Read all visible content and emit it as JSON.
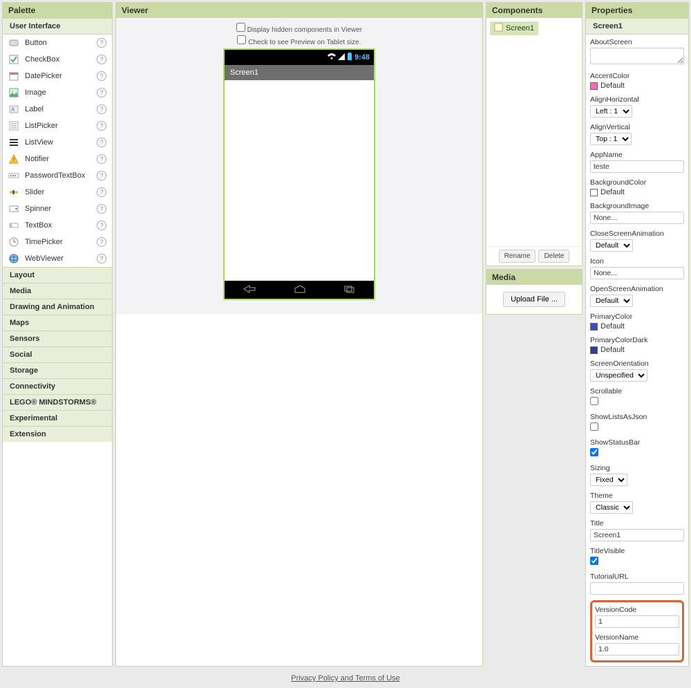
{
  "palette": {
    "title": "Palette",
    "ui_group": "User Interface",
    "items": [
      {
        "label": "Button",
        "icon": "button-icon"
      },
      {
        "label": "CheckBox",
        "icon": "checkbox-icon"
      },
      {
        "label": "DatePicker",
        "icon": "datepicker-icon"
      },
      {
        "label": "Image",
        "icon": "image-icon"
      },
      {
        "label": "Label",
        "icon": "label-icon"
      },
      {
        "label": "ListPicker",
        "icon": "listpicker-icon"
      },
      {
        "label": "ListView",
        "icon": "listview-icon"
      },
      {
        "label": "Notifier",
        "icon": "notifier-icon"
      },
      {
        "label": "PasswordTextBox",
        "icon": "password-icon"
      },
      {
        "label": "Slider",
        "icon": "slider-icon"
      },
      {
        "label": "Spinner",
        "icon": "spinner-icon"
      },
      {
        "label": "TextBox",
        "icon": "textbox-icon"
      },
      {
        "label": "TimePicker",
        "icon": "timepicker-icon"
      },
      {
        "label": "WebViewer",
        "icon": "webviewer-icon"
      }
    ],
    "groups": [
      "Layout",
      "Media",
      "Drawing and Animation",
      "Maps",
      "Sensors",
      "Social",
      "Storage",
      "Connectivity",
      "LEGO® MINDSTORMS®",
      "Experimental",
      "Extension"
    ]
  },
  "viewer": {
    "title": "Viewer",
    "opt1": "Display hidden components in Viewer",
    "opt2": "Check to see Preview on Tablet size.",
    "phone_time": "9:48",
    "screen_title": "Screen1"
  },
  "components": {
    "title": "Components",
    "root": "Screen1",
    "rename": "Rename",
    "delete": "Delete"
  },
  "media": {
    "title": "Media",
    "upload": "Upload File ..."
  },
  "properties": {
    "title": "Properties",
    "screen_name": "Screen1",
    "AboutScreen": {
      "label": "AboutScreen",
      "value": ""
    },
    "AccentColor": {
      "label": "AccentColor",
      "value": "Default",
      "color": "#ff4081"
    },
    "AlignHorizontal": {
      "label": "AlignHorizontal",
      "value": "Left : 1"
    },
    "AlignVertical": {
      "label": "AlignVertical",
      "value": "Top : 1"
    },
    "AppName": {
      "label": "AppName",
      "value": "teste"
    },
    "BackgroundColor": {
      "label": "BackgroundColor",
      "value": "Default",
      "color": "#ffffff"
    },
    "BackgroundImage": {
      "label": "BackgroundImage",
      "value": "None..."
    },
    "CloseScreenAnimation": {
      "label": "CloseScreenAnimation",
      "value": "Default"
    },
    "Icon": {
      "label": "Icon",
      "value": "None..."
    },
    "OpenScreenAnimation": {
      "label": "OpenScreenAnimation",
      "value": "Default"
    },
    "PrimaryColor": {
      "label": "PrimaryColor",
      "value": "Default",
      "color": "#3f51b5"
    },
    "PrimaryColorDark": {
      "label": "PrimaryColorDark",
      "value": "Default",
      "color": "#303f9f"
    },
    "ScreenOrientation": {
      "label": "ScreenOrientation",
      "value": "Unspecified"
    },
    "Scrollable": {
      "label": "Scrollable",
      "checked": false
    },
    "ShowListsAsJson": {
      "label": "ShowListsAsJson",
      "checked": false
    },
    "ShowStatusBar": {
      "label": "ShowStatusBar",
      "checked": true
    },
    "Sizing": {
      "label": "Sizing",
      "value": "Fixed"
    },
    "Theme": {
      "label": "Theme",
      "value": "Classic"
    },
    "Title": {
      "label": "Title",
      "value": "Screen1"
    },
    "TitleVisible": {
      "label": "TitleVisible",
      "checked": true
    },
    "TutorialURL": {
      "label": "TutorialURL",
      "value": ""
    },
    "VersionCode": {
      "label": "VersionCode",
      "value": "1"
    },
    "VersionName": {
      "label": "VersionName",
      "value": "1.0"
    }
  },
  "footer": {
    "link": "Privacy Policy and Terms of Use"
  }
}
